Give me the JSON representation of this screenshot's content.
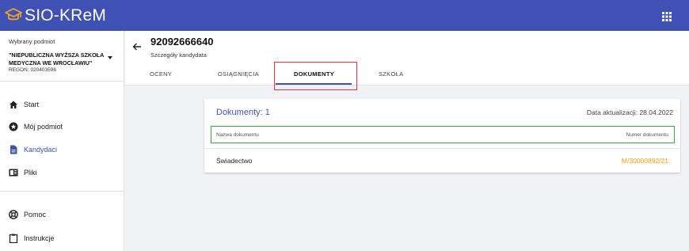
{
  "app": {
    "title": "SIO-KReM",
    "logo_icon": "graduation-cap-icon",
    "apps_icon": "apps-grid-icon"
  },
  "sidebar": {
    "subject_label": "Wybrany podmiot",
    "subject_name": "\"NIEPUBLICZNA WYŻSZA SZKOŁA MEDYCZNA WE WROCŁAWIU\"",
    "subject_regon": "REGON: 020403596",
    "items": [
      {
        "label": "Start",
        "icon": "home-icon"
      },
      {
        "label": "Mój podmiot",
        "icon": "star-circle-icon"
      },
      {
        "label": "Kandydaci",
        "icon": "document-icon",
        "active": true
      },
      {
        "label": "Pliki",
        "icon": "files-icon"
      },
      {
        "label": "Pomoc",
        "icon": "lifebuoy-icon"
      },
      {
        "label": "Instrukcje",
        "icon": "clipboard-icon"
      }
    ],
    "accent": "#3f51b5"
  },
  "header": {
    "candidate_id": "92092666640",
    "subtitle": "Szczegóły kandydata",
    "tabs": [
      {
        "label": "OCENY"
      },
      {
        "label": "OSIĄGNIĘCIA"
      },
      {
        "label": "DOKUMENTY",
        "active": true
      },
      {
        "label": "SZKOŁA"
      }
    ]
  },
  "documents": {
    "title": "Dokumenty: 1",
    "updated": "Data aktualizacji: 28.04.2022",
    "columns": {
      "name": "Nazwa dokumentu",
      "number": "Numer dokumentu"
    },
    "rows": [
      {
        "name": "Świadectwo",
        "number": "M/30000892/21"
      }
    ],
    "number_color": "#f39c12"
  },
  "colors": {
    "topbar": "#3f51b5",
    "highlight_tab": "#e53935",
    "highlight_columns": "#43a047"
  }
}
